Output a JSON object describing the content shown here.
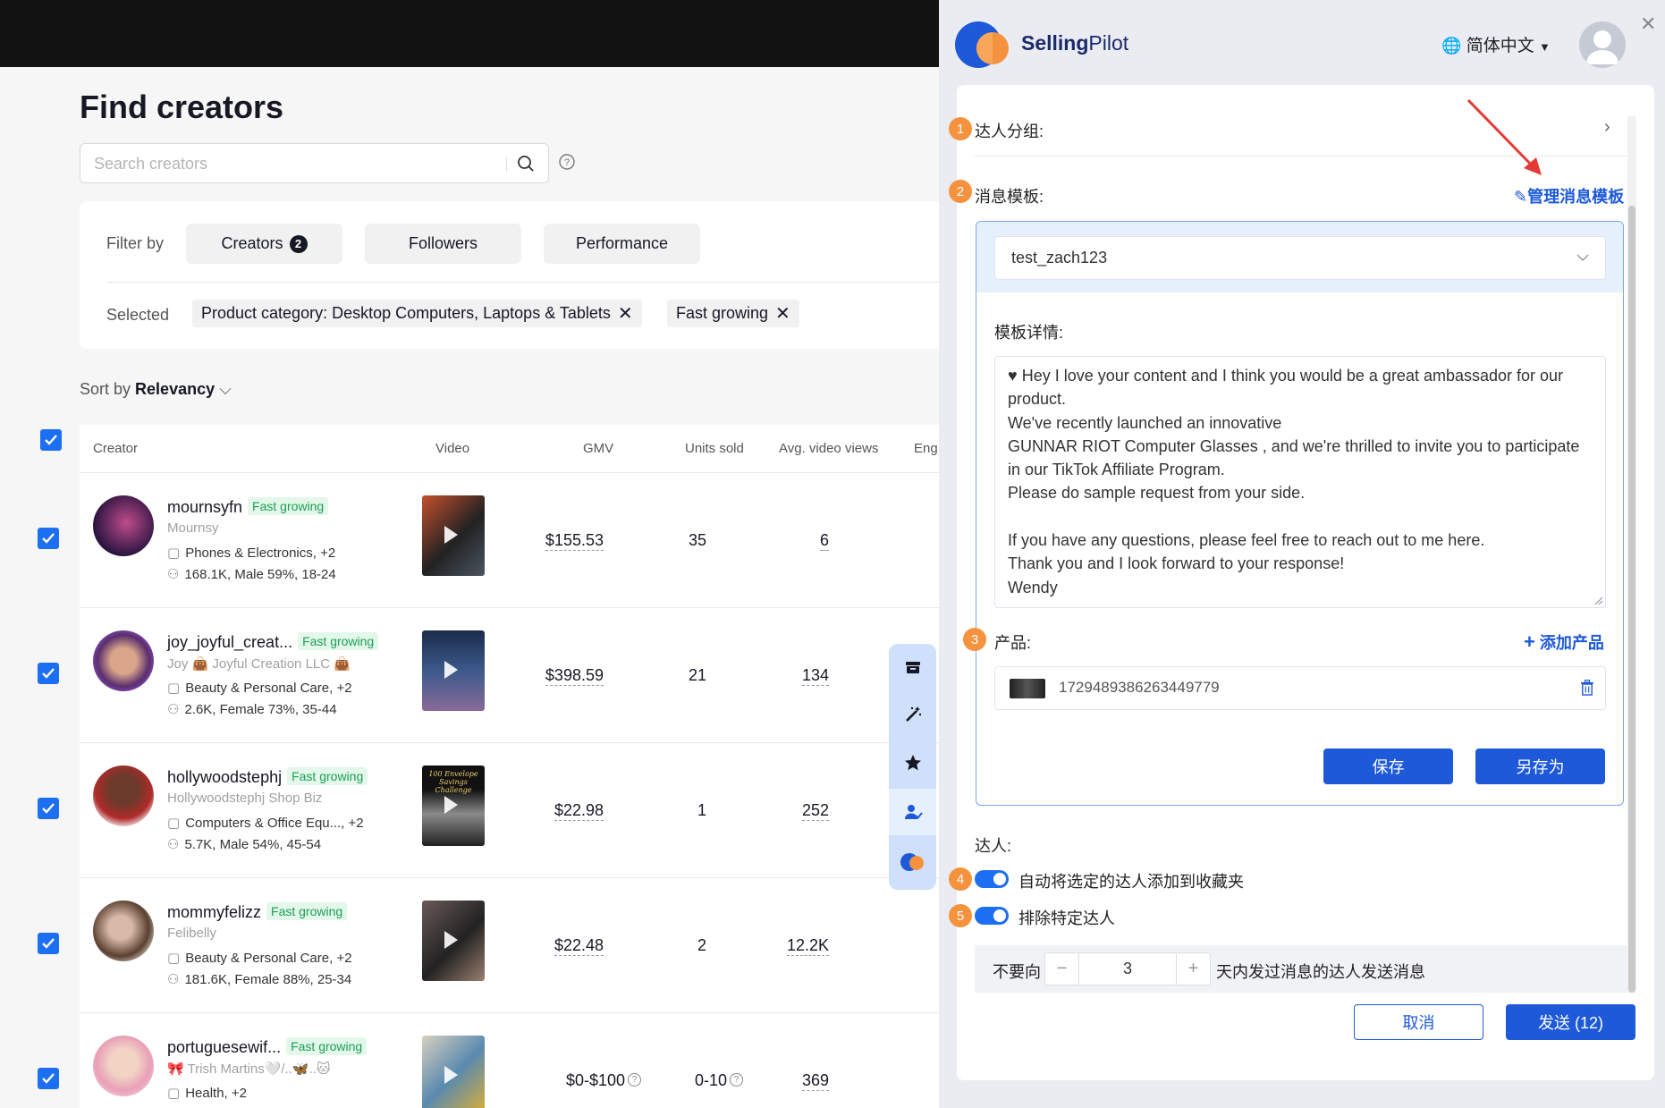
{
  "page": {
    "title": "Find creators",
    "search_placeholder": "Search creators",
    "filter_by_label": "Filter by",
    "filters": [
      {
        "label": "Creators",
        "count": "2"
      },
      {
        "label": "Followers"
      },
      {
        "label": "Performance"
      }
    ],
    "selected_label": "Selected",
    "selected_tags": [
      "Product category: Desktop Computers, Laptops & Tablets",
      "Fast growing"
    ],
    "sort_by_label": "Sort by",
    "sort_value": "Relevancy"
  },
  "table": {
    "headers": [
      "Creator",
      "Video",
      "GMV",
      "Units sold",
      "Avg. video views",
      "Eng"
    ],
    "rows": [
      {
        "username": "mournsyfn",
        "badge": "Fast growing",
        "nickname": "Mournsy",
        "category": "Phones & Electronics, +2",
        "audience": "168.1K, Male 59%, 18-24",
        "gmv": "$155.53",
        "units": "35",
        "views": "6"
      },
      {
        "username": "joy_joyful_creat...",
        "badge": "Fast growing",
        "nickname": "Joy 👜 Joyful Creation LLC 👜",
        "category": "Beauty & Personal Care, +2",
        "audience": "2.6K, Female 73%, 35-44",
        "gmv": "$398.59",
        "units": "21",
        "views": "134"
      },
      {
        "username": "hollywoodstephj",
        "badge": "Fast growing",
        "nickname": "Hollywoodstephj Shop Biz",
        "category": "Computers & Office Equ..., +2",
        "audience": "5.7K, Male 54%, 45-54",
        "gmv": "$22.98",
        "units": "1",
        "views": "252",
        "video_caption": "100 Envelope Savings Challenge"
      },
      {
        "username": "mommyfelizz",
        "badge": "Fast growing",
        "nickname": "Felibelly",
        "category": "Beauty & Personal Care, +2",
        "audience": "181.6K, Female 88%, 25-34",
        "gmv": "$22.48",
        "units": "2",
        "views": "12.2K"
      },
      {
        "username": "portuguesewif...",
        "badge": "Fast growing",
        "nickname": "🎀 Trish Martins🤍/..🦋..🐱",
        "category": "Health, +2",
        "audience": "",
        "gmv": "$0-$100",
        "units": "0-10",
        "views": "369"
      }
    ]
  },
  "side_tools": [
    "archive-icon",
    "magic-wand-icon",
    "star-icon",
    "user-check-icon",
    "sellingpilot-logo-icon"
  ],
  "panel": {
    "brand_part1": "Selling",
    "brand_part2": "Pilot",
    "language": "简体中文",
    "group_label": "达人分组:",
    "template_label": "消息模板:",
    "manage_templates_link": "管理消息模板",
    "template_selected": "test_zach123",
    "template_detail_label": "模板详情:",
    "template_body": "♥ Hey I love your content and I think you would be a great ambassador for our product.\nWe've recently launched an innovative\nGUNNAR RIOT Computer Glasses , and we're thrilled to invite you to participate in our TikTok Affiliate Program.\nPlease do sample request from your side.\n\nIf you have any questions, please feel free to reach out to me here.\nThank you and I look forward to your response!\nWendy",
    "product_label": "产品:",
    "add_product_link": "添加产品",
    "product_id": "1729489386263449779",
    "save_button": "保存",
    "save_as_button": "另存为",
    "creators_label": "达人:",
    "auto_add_toggle_label": "自动将选定的达人添加到收藏夹",
    "exclude_toggle_label": "排除特定达人",
    "days_prefix": "不要向",
    "days_value": "3",
    "days_suffix": "天内发过消息的达人发送消息",
    "cancel_button": "取消",
    "send_button": "发送 (12)",
    "step_numbers": [
      "1",
      "2",
      "3",
      "4",
      "5"
    ]
  },
  "colors": {
    "accent": "#1d59d8",
    "checkbox": "#1d6ff2",
    "step_badge": "#f5923e",
    "fast_growing_text": "#1c9e55",
    "fast_growing_bg": "#e3f7ea",
    "annotation_arrow": "#e53935"
  }
}
